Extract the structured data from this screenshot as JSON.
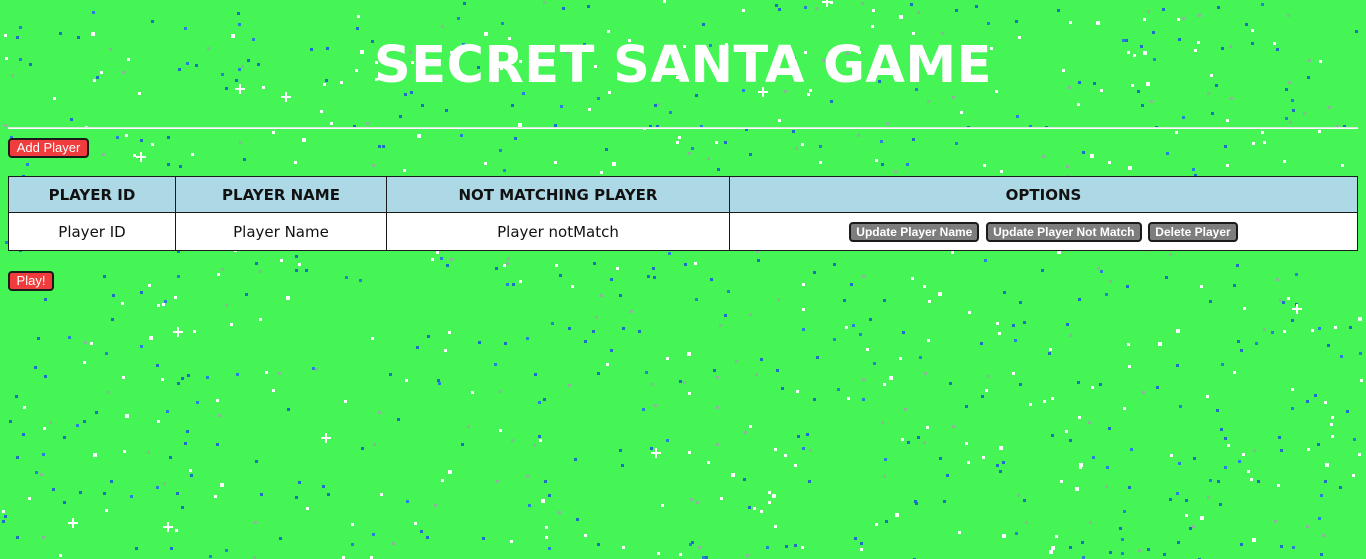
{
  "page": {
    "title": "SECRET SANTA GAME",
    "background_color": "#44f555"
  },
  "toolbar": {
    "add_player_label": "Add Player",
    "play_label": "Play!"
  },
  "table": {
    "headers": [
      "PLAYER ID",
      "PLAYER NAME",
      "NOT MATCHING PLAYER",
      "OPTIONS"
    ],
    "rows": [
      {
        "player_id": "Player ID",
        "player_name": "Player Name",
        "not_match": "Player notMatch",
        "actions": {
          "update_name": "Update Player Name",
          "update_not_match": "Update Player Not Match",
          "delete": "Delete Player"
        }
      }
    ]
  },
  "colors": {
    "header_bg": "#add8e6",
    "primary_button": "#f03c3c",
    "secondary_button": "#7d7d7d"
  }
}
